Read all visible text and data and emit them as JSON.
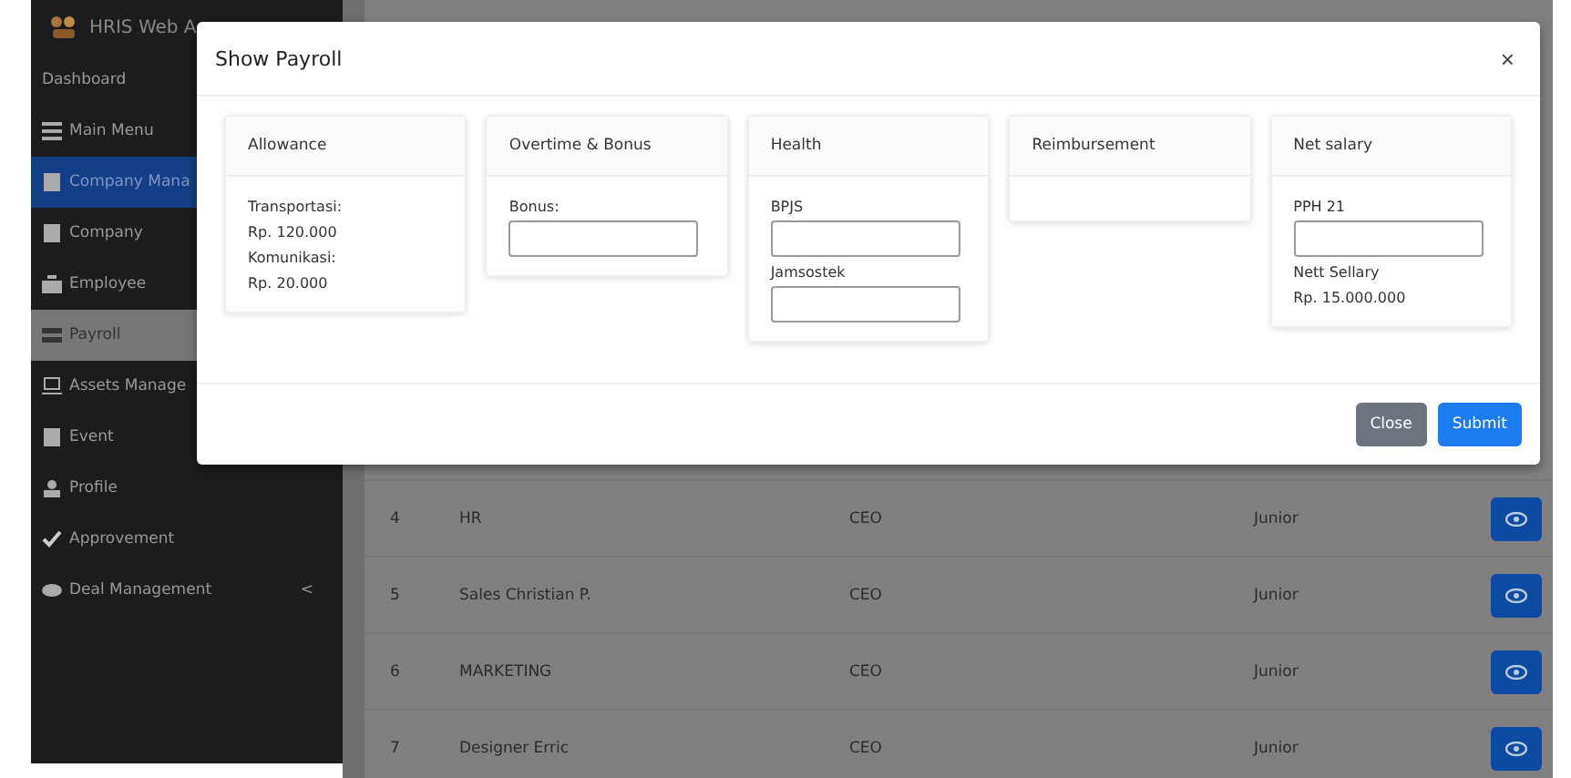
{
  "sidebar": {
    "brand": "HRIS Web A",
    "items": [
      {
        "label": "Dashboard",
        "selected": false,
        "kind": "item"
      },
      {
        "label": "Main Menu",
        "selected": false,
        "kind": "item"
      },
      {
        "label": "Company Mana",
        "selected": false,
        "kind": "group"
      },
      {
        "label": "Company",
        "selected": false,
        "kind": "item"
      },
      {
        "label": "Employee",
        "selected": false,
        "kind": "item"
      },
      {
        "label": "Payroll",
        "selected": true,
        "kind": "item"
      },
      {
        "label": "Assets Manage",
        "selected": false,
        "kind": "item"
      },
      {
        "label": "Event",
        "selected": false,
        "kind": "item"
      },
      {
        "label": "Profile",
        "selected": false,
        "kind": "item"
      },
      {
        "label": "Approvement",
        "selected": false,
        "kind": "item"
      },
      {
        "label": "Deal Management",
        "selected": false,
        "kind": "item",
        "caret": "<"
      }
    ]
  },
  "table": {
    "rows": [
      {
        "number": "4",
        "name": "HR",
        "position": "CEO",
        "level": "Junior"
      },
      {
        "number": "5",
        "name": "Sales Christian P.",
        "position": "CEO",
        "level": "Junior"
      },
      {
        "number": "6",
        "name": "MARKETING",
        "position": "CEO",
        "level": "Junior"
      },
      {
        "number": "7",
        "name": "Designer Erric",
        "position": "CEO",
        "level": "Junior"
      }
    ]
  },
  "modal": {
    "title": "Show Payroll",
    "close_glyph": "×",
    "cards": [
      {
        "title": "Allowance",
        "body": [
          {
            "kind": "text",
            "text": "Transportasi:"
          },
          {
            "kind": "text",
            "text": "Rp. 120.000"
          },
          {
            "kind": "text",
            "text": "Komunikasi:"
          },
          {
            "kind": "text",
            "text": "Rp. 20.000"
          }
        ]
      },
      {
        "title": "Overtime & Bonus",
        "body": [
          {
            "kind": "text",
            "text": "Bonus:"
          },
          {
            "kind": "field"
          }
        ]
      },
      {
        "title": "Health",
        "body": [
          {
            "kind": "text",
            "text": "BPJS"
          },
          {
            "kind": "field"
          },
          {
            "kind": "text",
            "text": "Jamsostek"
          },
          {
            "kind": "field"
          }
        ]
      },
      {
        "title": "Reimbursement"
      },
      {
        "title": "Net salary",
        "body": [
          {
            "kind": "text",
            "text": "PPH 21"
          },
          {
            "kind": "field"
          },
          {
            "kind": "text",
            "text": "Nett Sellary"
          },
          {
            "kind": "text",
            "text": "Rp. 15.000.000"
          }
        ]
      }
    ],
    "buttons": [
      {
        "label": "Close",
        "kind": "secondary"
      },
      {
        "label": "Submit",
        "kind": "primary"
      }
    ]
  }
}
